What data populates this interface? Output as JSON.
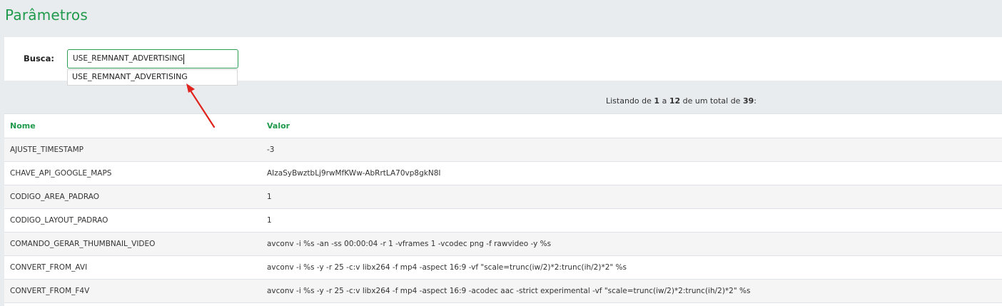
{
  "page": {
    "title": "Parâmetros"
  },
  "search": {
    "label": "Busca:",
    "value": "USE_REMNANT_ADVERTISING",
    "suggestion": "USE_REMNANT_ADVERTISING"
  },
  "listing": {
    "prefix": "Listando de",
    "from": "1",
    "sep1": "a",
    "to": "12",
    "sep2": "de um total de",
    "total": "39",
    "suffix": ":"
  },
  "table": {
    "headers": {
      "name": "Nome",
      "value": "Valor"
    },
    "rows": [
      {
        "name": "AJUSTE_TIMESTAMP",
        "value": "-3"
      },
      {
        "name": "CHAVE_API_GOOGLE_MAPS",
        "value": "AIzaSyBwztbLj9rwMfKWw-AbRrtLA70vp8gkN8I"
      },
      {
        "name": "CODIGO_AREA_PADRAO",
        "value": "1"
      },
      {
        "name": "CODIGO_LAYOUT_PADRAO",
        "value": "1"
      },
      {
        "name": "COMANDO_GERAR_THUMBNAIL_VIDEO",
        "value": "avconv -i %s -an -ss 00:00:04 -r 1 -vframes 1 -vcodec png -f rawvideo -y %s"
      },
      {
        "name": "CONVERT_FROM_AVI",
        "value": "avconv -i %s -y -r 25 -c:v libx264 -f mp4 -aspect 16:9 -vf \"scale=trunc(iw/2)*2:trunc(ih/2)*2\" %s"
      },
      {
        "name": "CONVERT_FROM_F4V",
        "value": "avconv -i %s -y -r 25 -c:v libx264 -f mp4 -aspect 16:9 -acodec aac -strict experimental -vf \"scale=trunc(iw/2)*2:trunc(ih/2)*2\" %s"
      }
    ]
  },
  "colors": {
    "accent": "#1f9a4c",
    "annotation_arrow": "#e0231c"
  }
}
